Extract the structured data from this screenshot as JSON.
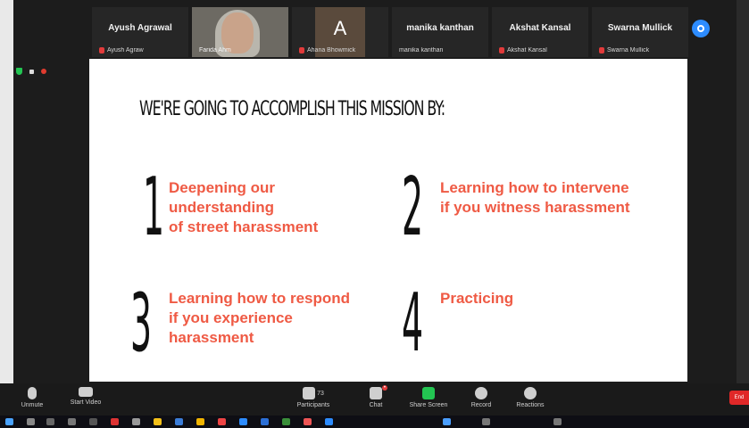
{
  "gallery": {
    "participants": [
      {
        "name": "Ayush Agrawal",
        "sub": "Ayush Agraw"
      },
      {
        "name": "",
        "sub": "Farida Ahm",
        "video": true
      },
      {
        "name": "A",
        "sub": "Ahana Bhowmick",
        "avatar": true
      },
      {
        "name": "manika kanthan",
        "sub": "manika kanthan"
      },
      {
        "name": "Akshat Kansal",
        "sub": "Akshat Kansal"
      },
      {
        "name": "Swarna Mullick",
        "sub": "Swarna Mullick"
      }
    ]
  },
  "slide": {
    "title": "WE'RE GOING TO ACCOMPLISH THIS MISSION BY:",
    "items": [
      {
        "number": "1",
        "text": "Deepening our\nunderstanding\nof street harassment"
      },
      {
        "number": "2",
        "text": "Learning how to intervene\nif you witness harassment"
      },
      {
        "number": "3",
        "text": "Learning how to respond\nif you experience\nharassment"
      },
      {
        "number": "4",
        "text": "Practicing"
      }
    ],
    "text_color": "#ef5a44"
  },
  "toolbar": {
    "unmute": "Unmute",
    "start_video": "Start Video",
    "participants": "Participants",
    "participants_count": "73",
    "chat": "Chat",
    "share_screen": "Share Screen",
    "record": "Record",
    "reactions": "Reactions",
    "end": "End"
  },
  "colors": {
    "share_green": "#23c552",
    "end_red": "#e02828",
    "zoom_blue": "#2d8cff"
  }
}
